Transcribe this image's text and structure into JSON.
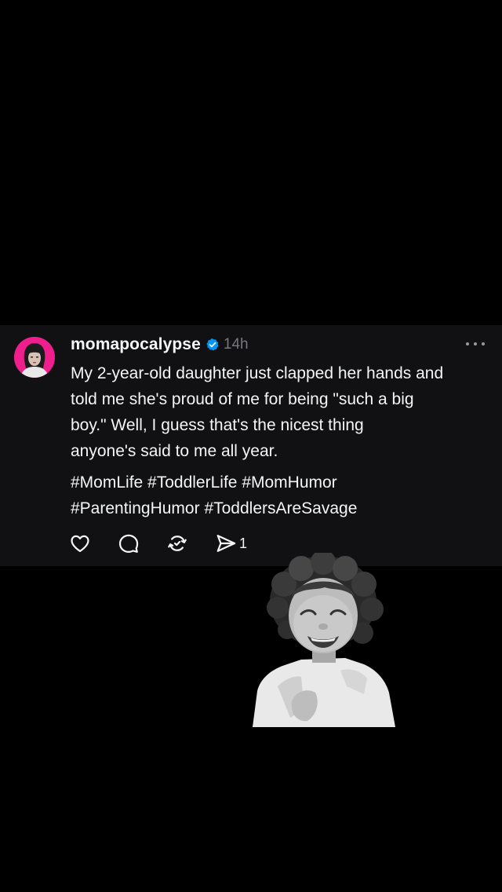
{
  "post": {
    "username": "momapocalypse",
    "verified": true,
    "timestamp": "14h",
    "avatar_color": "#ee1f8c",
    "body_lines": [
      "My 2-year-old daughter just clapped her hands and",
      "told me she's proud of me for being \"such a big",
      "boy.\" Well, I guess that's the nicest thing",
      "anyone's said to me all year."
    ],
    "hashtags_line1": [
      "#MomLife",
      "#ToddlerLife",
      "#MomHumor"
    ],
    "hashtags_line2": [
      "#ParentingHumor",
      "#ToddlersAreSavage"
    ],
    "actions": {
      "like_icon": "heart-icon",
      "reply_icon": "comment-bubble-icon",
      "repost_icon": "repost-icon",
      "share_icon": "send-icon",
      "share_count": "1"
    }
  },
  "sticker": {
    "description_icon": "laughing-toddler-sticker"
  },
  "colors": {
    "background": "#000000",
    "card": "#111113",
    "text": "#f3f5f7",
    "muted": "#77777c",
    "verified": "#0095f6"
  }
}
